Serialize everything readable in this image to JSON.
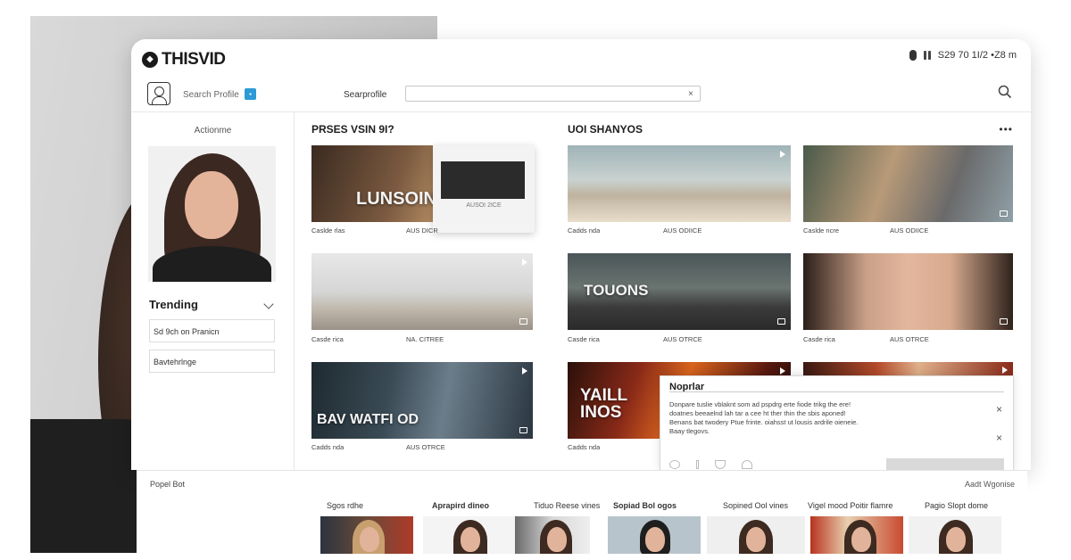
{
  "app": {
    "logo_text": "THISVID",
    "logo_mark": "◆"
  },
  "topbar": {
    "status_text": "S29 70 1I/2 •Z8 m"
  },
  "search": {
    "profile_label": "Search Profile",
    "label": "Searprofile",
    "value": "",
    "clear_icon": "×"
  },
  "sidebar": {
    "heading": "Actionme",
    "trending_title": "Trending",
    "items": [
      {
        "label": "Sd 9ch on Pranicn"
      },
      {
        "label": "Bavtehrlnge"
      }
    ]
  },
  "main": {
    "section_left_title": "PRSES VSIN 9I?",
    "section_right_title": "UOI SHANYOS",
    "more_icon": "•••",
    "videos": [
      {
        "title": "LUNSOIN",
        "meta_left": "Caslde rlas",
        "meta_right": "AUS DICR"
      },
      {
        "title": "",
        "meta_left": "Cadds nda",
        "meta_right": "AUS ODIICE"
      },
      {
        "title": "",
        "meta_left": "Caslde ncre",
        "meta_right": "AUS ODIICE"
      },
      {
        "title": "",
        "meta_left": "Casde rica",
        "meta_right": "NA. CITREE"
      },
      {
        "title": "TOUONS",
        "meta_left": "Casde rica",
        "meta_right": "AUS OTRCE"
      },
      {
        "title": "",
        "meta_left": "Casde rica",
        "meta_right": "AUS OTRCE"
      },
      {
        "title": "BAV WATFI OD",
        "meta_left": "Cadds nda",
        "meta_right": "AUS OTRCE"
      },
      {
        "title": "YAILL INOS",
        "meta_left": "Cadds nda",
        "meta_right": ""
      },
      {
        "title": "",
        "meta_left": "",
        "meta_right": ""
      }
    ],
    "overlay_label": "AUSOI 2ICE"
  },
  "popup": {
    "title": "Noprlar",
    "text": "Donpare tuslie vblaknt som ad pspdrg erte fiode trikg the ere! doatnes beeaelnd lah tar a cee ht ther thin the sbis aponed! Benans bat twodery Ptue frinte. oiahsst ut lousis ardrile oieneie. Baay tlegovs.",
    "close_icon": "×"
  },
  "bottom": {
    "title": "Popel Bot",
    "right_label": "Aadt Wgonise",
    "columns": [
      {
        "label": "Sgos rdhe"
      },
      {
        "label": "Aprapird dineo"
      },
      {
        "label": "Tiduo Reese vines"
      },
      {
        "label": "Sopiad Bol ogos"
      },
      {
        "label": "Sopined Ool vines"
      },
      {
        "label": "Vigel mood Poitir flamre"
      },
      {
        "label": "Pagio Slopt dome"
      }
    ]
  }
}
